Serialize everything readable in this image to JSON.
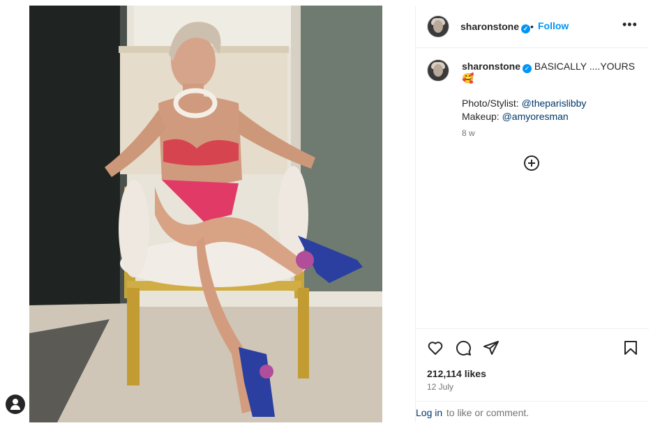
{
  "post": {
    "image_alt": "sharonstone post photo",
    "author": {
      "username": "sharonstone",
      "verified": true,
      "follow_label": "Follow",
      "separator": "•",
      "more_label": "•••"
    },
    "caption": {
      "username": "sharonstone",
      "text": "BASICALLY ....YOURS",
      "emoji": "🥰",
      "credits": [
        {
          "label": "Photo/Stylist: ",
          "handle": "@theparislibby"
        },
        {
          "label": "Makeup: ",
          "handle": "@amyoresman"
        }
      ],
      "age": "8 w"
    },
    "icons": {
      "add_comment": "add-circle-icon",
      "like": "heart-icon",
      "comment": "comment-icon",
      "share": "paper-plane-icon",
      "save": "bookmark-icon",
      "verified": "verified-badge-icon",
      "profile": "user-icon"
    },
    "likes": "212,114 likes",
    "date": "12 July",
    "login": {
      "link": "Log in",
      "rest": " to like or comment."
    }
  },
  "colors": {
    "accent": "#0095f6",
    "link": "#00376b",
    "text": "#262626",
    "muted": "#737373",
    "border": "#efefef"
  }
}
